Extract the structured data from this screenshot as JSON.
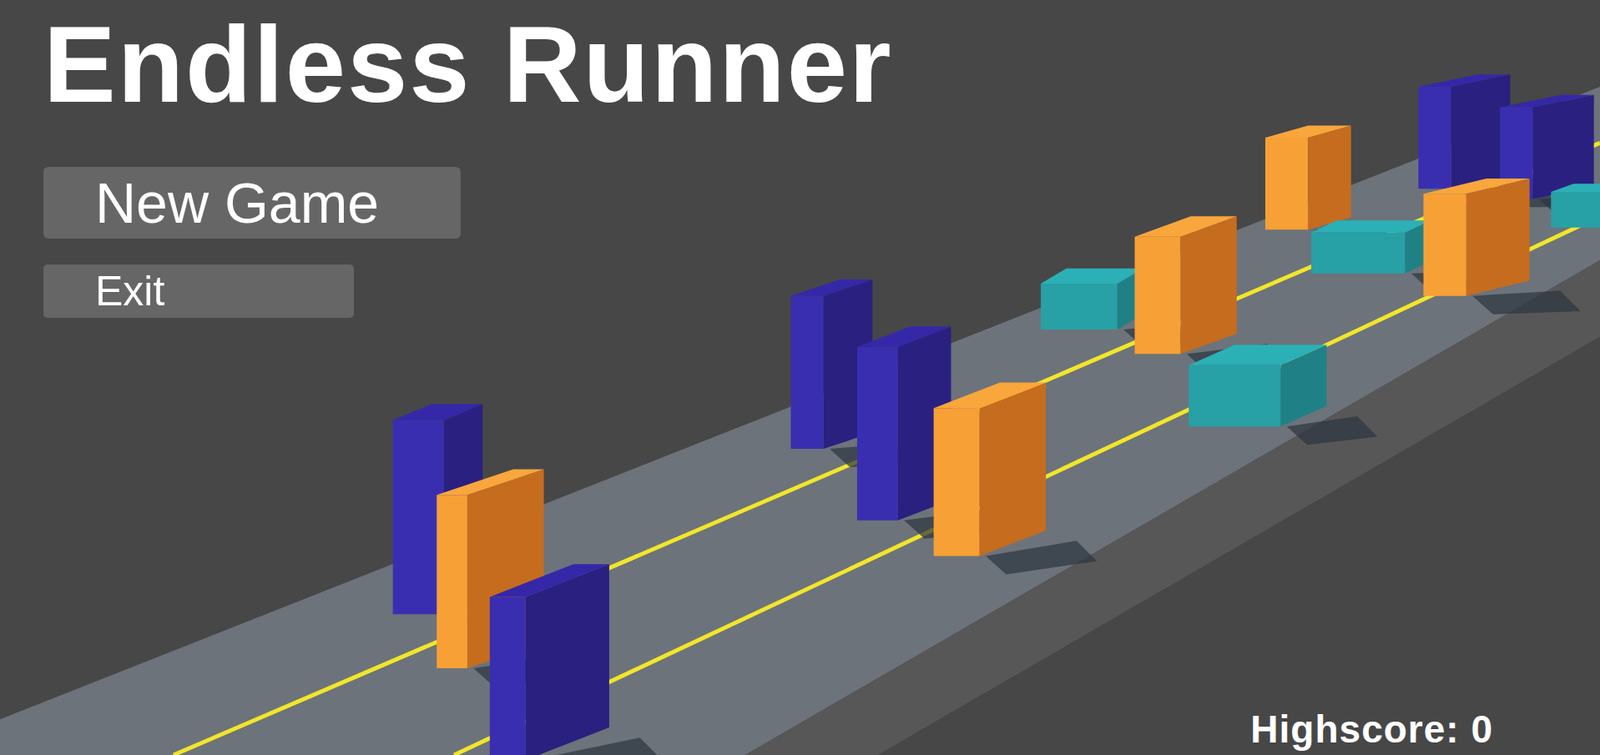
{
  "title": "Endless Runner",
  "menu": [
    {
      "label": "New Game",
      "kind": "large"
    },
    {
      "label": "Exit",
      "kind": "small"
    }
  ],
  "highscore": "Highscore: 0"
}
